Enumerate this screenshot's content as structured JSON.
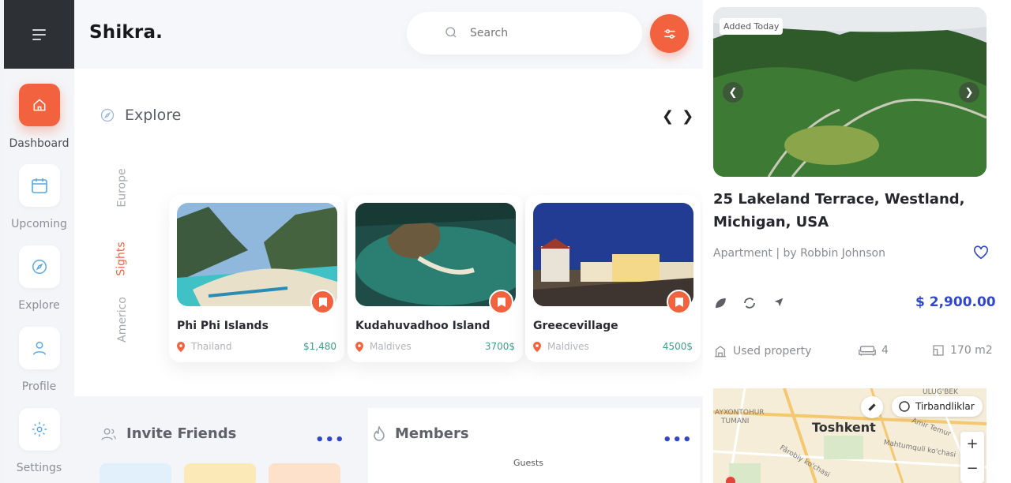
{
  "app": {
    "brand": "Shikra."
  },
  "search": {
    "placeholder": "Search"
  },
  "sidebar": {
    "items": [
      {
        "label": "Dashboard",
        "icon": "home-icon",
        "active": true
      },
      {
        "label": "Upcoming",
        "icon": "calendar-icon",
        "active": false
      },
      {
        "label": "Explore",
        "icon": "compass-icon",
        "active": false
      },
      {
        "label": "Profile",
        "icon": "user-icon",
        "active": false
      },
      {
        "label": "Settings",
        "icon": "gear-icon",
        "active": false
      }
    ]
  },
  "explore": {
    "title": "Explore",
    "categories": [
      "Europe",
      "Sights",
      "Americo"
    ],
    "active_category": "Sights",
    "cards": [
      {
        "name": "Phi Phi Islands",
        "location": "Thailand",
        "price": "$1,480"
      },
      {
        "name": "Kudahuvadhoo Island",
        "location": "Maldives",
        "price": "3700$"
      },
      {
        "name": "Greecevillage",
        "location": "Maldives",
        "price": "4500$"
      }
    ]
  },
  "invite": {
    "title": "Invite Friends",
    "more": "•••"
  },
  "members": {
    "title": "Members",
    "more": "•••",
    "guests_label": "Guests"
  },
  "listing": {
    "badge": "Added Today",
    "address": "25 Lakeland Terrace, Westland, Michigan, USA",
    "subtitle": "Apartment | by Robbin Johnson",
    "price": "$ 2,900.00",
    "property_type": "Used property",
    "rooms": "4",
    "area": "170 m2"
  },
  "map": {
    "city": "Toshkent",
    "traffic_label": "Tirbandliklar",
    "labels": [
      "AYXONTOHUR",
      "TUMANI",
      "ULUG'BEK",
      "Fârobiy ko'chasi",
      "Mahtumquli ko'chasi",
      "Amir Temur"
    ],
    "zoom_in": "+",
    "zoom_out": "−"
  },
  "colors": {
    "accent": "#f2623f",
    "price_blue": "#2f47c8",
    "price_green": "#3f9c88",
    "dark": "#2d3035"
  }
}
